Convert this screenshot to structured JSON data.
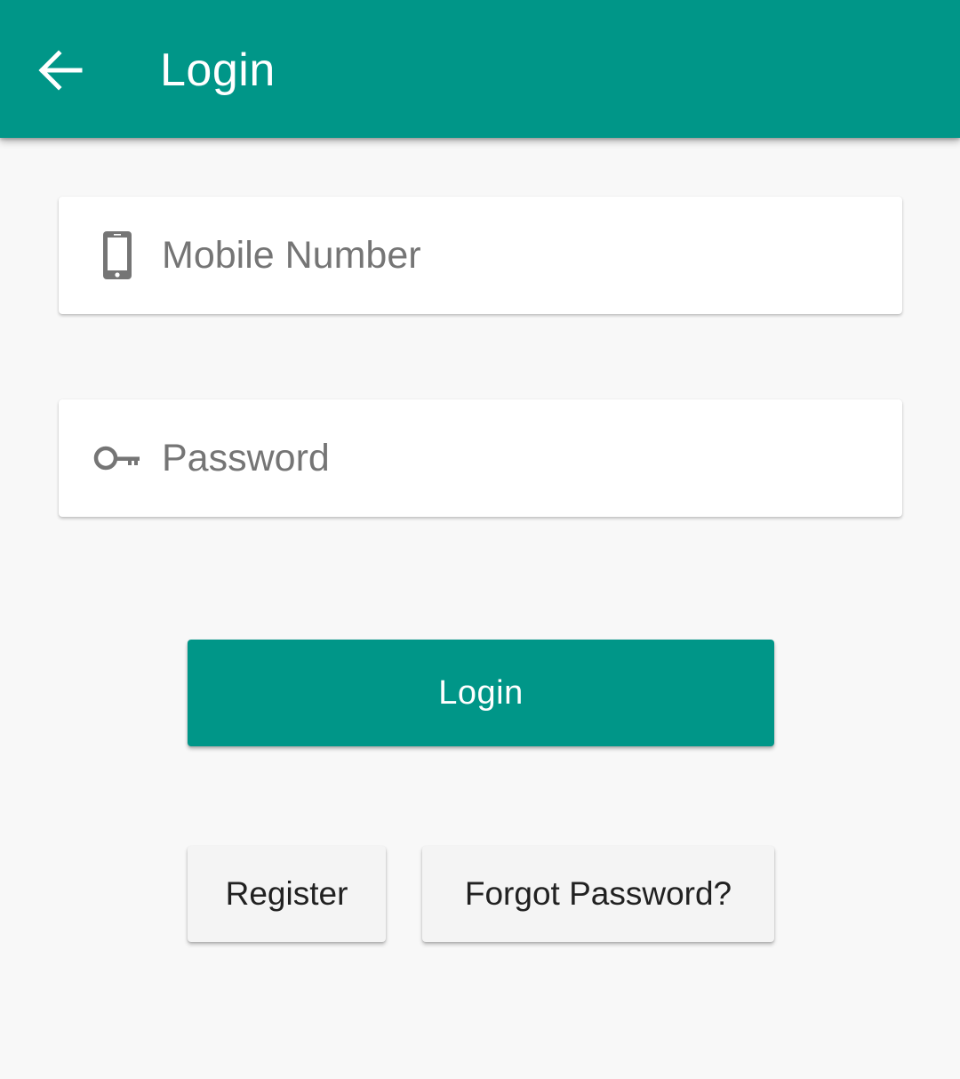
{
  "app_bar": {
    "title": "Login",
    "back_icon": "arrow-left-icon",
    "color": "#009688"
  },
  "form": {
    "mobile": {
      "placeholder": "Mobile Number",
      "value": "",
      "icon": "smartphone-icon"
    },
    "password": {
      "placeholder": "Password",
      "value": "",
      "icon": "key-icon"
    }
  },
  "actions": {
    "login_label": "Login",
    "register_label": "Register",
    "forgot_label": "Forgot Password?"
  },
  "colors": {
    "accent": "#009688",
    "background": "#f8f8f8",
    "icon_gray": "#757575"
  }
}
